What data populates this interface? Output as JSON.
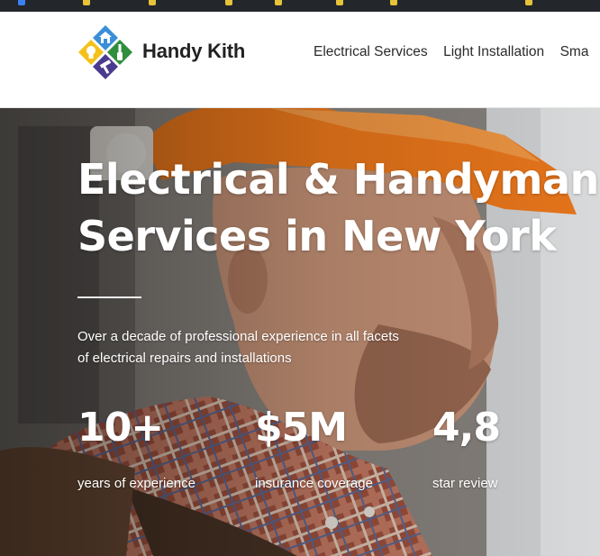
{
  "header": {
    "brand_name": "Handy Kith",
    "nav": [
      {
        "label": "Electrical Services"
      },
      {
        "label": "Light Installation"
      },
      {
        "label": "Sma"
      }
    ]
  },
  "hero": {
    "title_line1": "Electrical & Handyman",
    "title_line2": "Services in New York",
    "subtitle": "Over a decade of professional experience in all facets of electrical repairs and installations",
    "stats": [
      {
        "value": "10+",
        "label": "years of experience"
      },
      {
        "value": "$5M",
        "label": "insurance coverage"
      },
      {
        "value": "4,8",
        "label": "star review"
      }
    ]
  },
  "colors": {
    "logo_blue": "#3b8fd9",
    "logo_green": "#2f8f3e",
    "logo_yellow": "#f3c11a",
    "logo_purple": "#4b3b8f",
    "hardhat_orange": "#f07a1c"
  },
  "icons": {
    "logo": "house-bulb-wrench-logo-icon"
  }
}
